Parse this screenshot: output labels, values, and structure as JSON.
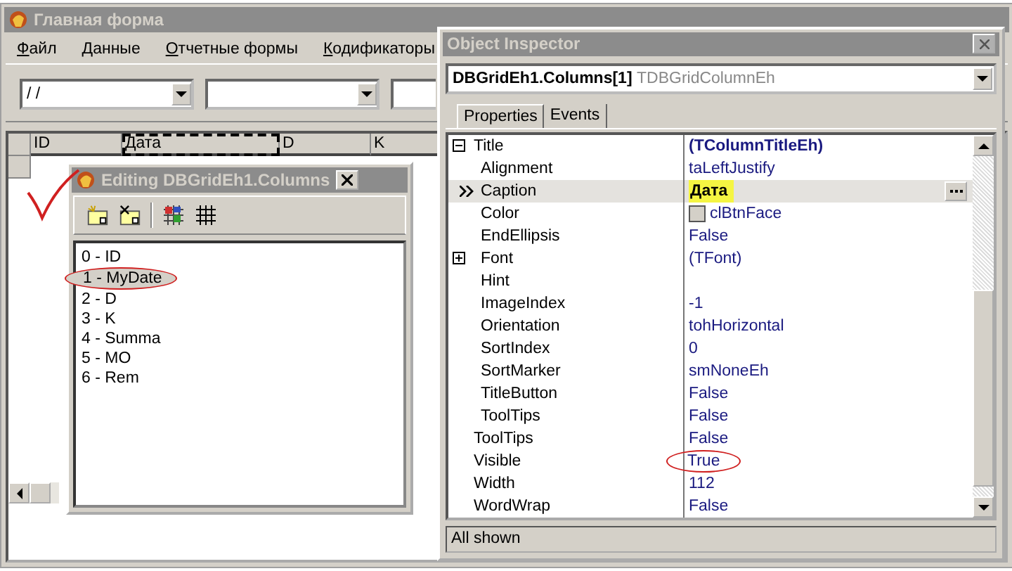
{
  "main_form": {
    "title": "Главная форма",
    "menu": [
      {
        "label": "Файл"
      },
      {
        "label": "Данные"
      },
      {
        "label": "Отчетные формы"
      },
      {
        "label": "Кодификаторы"
      }
    ],
    "combos": [
      {
        "kind": "date",
        "value": " / /"
      },
      {
        "kind": "plain"
      }
    ],
    "grid": {
      "columns": [
        {
          "title": "ID",
          "selected": false
        },
        {
          "title": "Дата",
          "selected": true
        },
        {
          "title": "D",
          "selected": false
        },
        {
          "title": "K",
          "selected": false
        }
      ]
    }
  },
  "columns_editor": {
    "title": "Editing DBGridEh1.Columns",
    "items": [
      {
        "label": "0 - ID",
        "selected": false,
        "circled": false
      },
      {
        "label": "1 - MyDate",
        "selected": true,
        "circled": true
      },
      {
        "label": "2 - D",
        "selected": false,
        "circled": false
      },
      {
        "label": "3 - K",
        "selected": false,
        "circled": false
      },
      {
        "label": "4 - Summa",
        "selected": false,
        "circled": false
      },
      {
        "label": "5 - MO",
        "selected": false,
        "circled": false
      },
      {
        "label": "6 - Rem",
        "selected": false,
        "circled": false
      }
    ]
  },
  "object_inspector": {
    "title": "Object Inspector",
    "object": "DBGridEh1.Columns[1]",
    "object_type": "TDBGridColumnEh",
    "tabs": [
      {
        "label": "Properties",
        "selected": true
      },
      {
        "label": "Events",
        "selected": false
      }
    ],
    "properties": [
      {
        "name": "Title",
        "value": "(TColumnTitleEh)",
        "kind": "object",
        "expanded": true,
        "selected": false,
        "children": [
          {
            "name": "Alignment",
            "value": "taLeftJustify",
            "kind": "text",
            "selected": false
          },
          {
            "name": "Caption",
            "value": "Дата",
            "kind": "text",
            "selected": true,
            "highlighted": true
          },
          {
            "name": "Color",
            "value": "clBtnFace",
            "kind": "color",
            "selected": false
          },
          {
            "name": "EndEllipsis",
            "value": "False",
            "kind": "text",
            "selected": false
          },
          {
            "name": "Font",
            "value": "(TFont)",
            "kind": "object",
            "expanded": false,
            "selected": false
          },
          {
            "name": "Hint",
            "kind": "text",
            "selected": false
          },
          {
            "name": "ImageIndex",
            "value": "-1",
            "kind": "text",
            "selected": false
          },
          {
            "name": "Orientation",
            "value": "tohHorizontal",
            "kind": "text",
            "selected": false
          },
          {
            "name": "SortIndex",
            "value": "0",
            "kind": "text",
            "selected": false
          },
          {
            "name": "SortMarker",
            "value": "smNoneEh",
            "kind": "text",
            "selected": false
          },
          {
            "name": "TitleButton",
            "value": "False",
            "kind": "text",
            "selected": false
          },
          {
            "name": "ToolTips",
            "value": "False",
            "kind": "text",
            "selected": false
          }
        ]
      },
      {
        "name": "ToolTips",
        "value": "False",
        "kind": "text",
        "selected": false
      },
      {
        "name": "Visible",
        "value": "True",
        "kind": "text",
        "selected": false,
        "circled": true
      },
      {
        "name": "Width",
        "value": "112",
        "kind": "text",
        "selected": false
      },
      {
        "name": "WordWrap",
        "value": "False",
        "kind": "text",
        "selected": false
      }
    ],
    "status": "All shown"
  },
  "annotations": [
    {
      "kind": "check"
    }
  ]
}
